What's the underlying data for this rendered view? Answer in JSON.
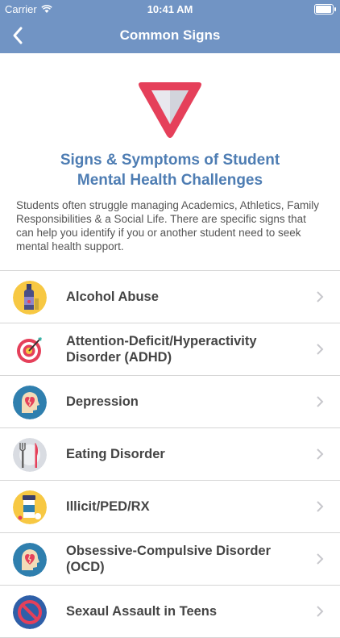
{
  "status": {
    "carrier": "Carrier",
    "time": "10:41 AM"
  },
  "nav": {
    "title": "Common Signs"
  },
  "hero": {
    "title_line1": "Signs & Symptoms of Student",
    "title_line2": "Mental Health Challenges",
    "description": "Students often struggle managing Academics, Athletics, Family Responsibilities & a Social Life. There are specific signs that can help you identify if you or another student need to seek mental health support."
  },
  "items": [
    {
      "label": "Alcohol Abuse",
      "icon": "alcohol-bottle-icon"
    },
    {
      "label": "Attention-Deficit/Hyperactivity Disorder (ADHD)",
      "icon": "target-icon"
    },
    {
      "label": "Depression",
      "icon": "broken-heart-head-icon"
    },
    {
      "label": "Eating Disorder",
      "icon": "fork-knife-icon"
    },
    {
      "label": "Illicit/PED/RX",
      "icon": "pill-bottle-icon"
    },
    {
      "label": "Obsessive-Compulsive Disorder (OCD)",
      "icon": "broken-heart-head-icon"
    },
    {
      "label": "Sexaul Assault in Teens",
      "icon": "no-sign-icon"
    }
  ],
  "colors": {
    "nav": "#7194c4",
    "title": "#4e7db3",
    "warning": "#e5405a"
  }
}
